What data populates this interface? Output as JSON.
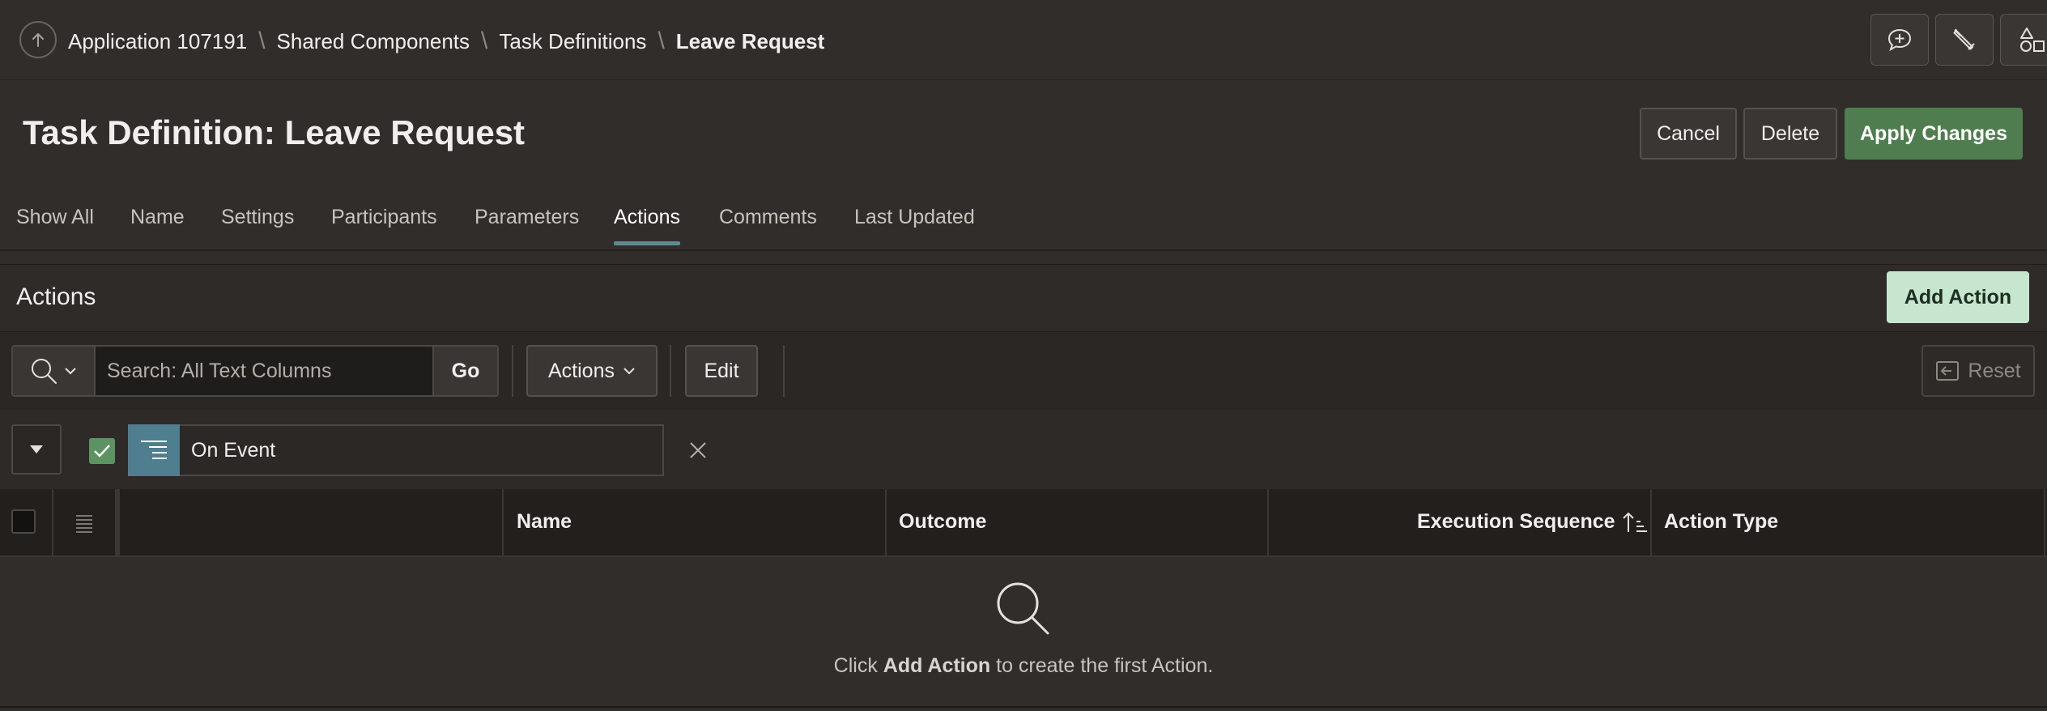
{
  "breadcrumb": {
    "items": [
      "Application 107191",
      "Shared Components",
      "Task Definitions"
    ],
    "current": "Leave Request"
  },
  "toolbar_icons": [
    "feedback-icon",
    "edit-pencil-icon",
    "shared-components-icon"
  ],
  "page": {
    "title": "Task Definition: Leave Request",
    "cancel_label": "Cancel",
    "delete_label": "Delete",
    "apply_label": "Apply Changes"
  },
  "tabs": [
    {
      "label": "Show All"
    },
    {
      "label": "Name"
    },
    {
      "label": "Settings"
    },
    {
      "label": "Participants"
    },
    {
      "label": "Parameters"
    },
    {
      "label": "Actions",
      "active": true
    },
    {
      "label": "Comments"
    },
    {
      "label": "Last Updated"
    }
  ],
  "region": {
    "title": "Actions",
    "add_label": "Add Action"
  },
  "ir_toolbar": {
    "search_placeholder": "Search: All Text Columns",
    "go_label": "Go",
    "actions_label": "Actions",
    "edit_label": "Edit",
    "reset_label": "Reset"
  },
  "filter": {
    "label": "On Event",
    "enabled": true
  },
  "grid": {
    "columns": [
      "Name",
      "Outcome",
      "Execution Sequence",
      "Action Type"
    ],
    "sorted_column": "Execution Sequence",
    "sort_direction": "ascending"
  },
  "empty_state": {
    "prefix": "Click ",
    "emphasis": "Add Action",
    "suffix": " to create the first Action."
  },
  "colors": {
    "background": "#312d2a",
    "primary_button": "#4f7d4f",
    "add_button": "#c6e6cf",
    "active_tab_underline": "#5f8a91",
    "filter_icon_bg": "#4f7e8f"
  }
}
